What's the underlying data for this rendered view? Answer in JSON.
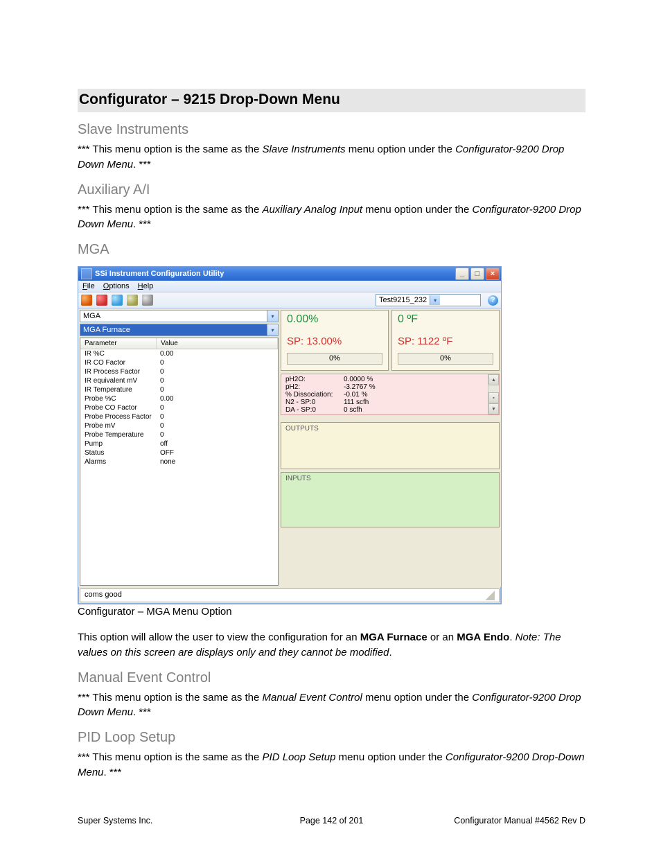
{
  "doc": {
    "h1": "Configurator – 9215 Drop-Down Menu",
    "sec1": {
      "title": "Slave Instruments",
      "p_a": "*** This menu option is the same as the ",
      "p_em": "Slave Instruments",
      "p_b": " menu option under the ",
      "p_em2": "Configurator-9200 Drop Down Menu",
      "p_c": ". ***"
    },
    "sec2": {
      "title": "Auxiliary A/I",
      "p_a": "*** This menu option is the same as the ",
      "p_em": "Auxiliary Analog Input",
      "p_b": " menu option under the ",
      "p_em2": "Configurator-9200 Drop Down Menu",
      "p_c": ". ***"
    },
    "sec3": {
      "title": "MGA"
    },
    "caption": "Configurator – MGA Menu Option",
    "para": {
      "a": "This option will allow the user to view the configuration for an ",
      "b1": "MGA Furnace",
      "mid": " or an ",
      "b2": "MGA Endo",
      "c": ".  ",
      "note": "Note: The values on this screen are displays only and they cannot be modified",
      "d": "."
    },
    "sec4": {
      "title": "Manual Event Control",
      "p_a": "*** This menu option is the same as the ",
      "p_em": "Manual Event Control",
      "p_b": " menu option under the ",
      "p_em2": "Configurator-9200 Drop Down Menu",
      "p_c": ". ***"
    },
    "sec5": {
      "title": "PID Loop Setup",
      "p_a": "*** This menu option is the same as the ",
      "p_em": "PID Loop Setup",
      "p_b": " menu option under the ",
      "p_em2": "Configurator-9200 Drop-Down Menu",
      "p_c": ". ***"
    }
  },
  "footer": {
    "left": "Super Systems Inc.",
    "mid": "Page 142 of 201",
    "right": "Configurator Manual #4562 Rev D"
  },
  "win": {
    "title": "SSi Instrument Configuration Utility",
    "menu": {
      "file": "File",
      "options": "Options",
      "help": "Help"
    },
    "device": "Test9215_232",
    "dd1": "MGA",
    "dd2": "MGA Furnace",
    "grid": {
      "h_param": "Parameter",
      "h_value": "Value",
      "rows": [
        {
          "p": "IR %C",
          "v": "0.00"
        },
        {
          "p": "IR CO Factor",
          "v": "0"
        },
        {
          "p": "IR Process Factor",
          "v": "0"
        },
        {
          "p": "IR equivalent mV",
          "v": "0"
        },
        {
          "p": "IR Temperature",
          "v": "0"
        },
        {
          "p": "Probe %C",
          "v": "0.00"
        },
        {
          "p": "Probe CO Factor",
          "v": "0"
        },
        {
          "p": "Probe Process Factor",
          "v": "0"
        },
        {
          "p": "Probe mV",
          "v": "0"
        },
        {
          "p": "Probe Temperature",
          "v": "0"
        },
        {
          "p": "Pump",
          "v": "off"
        },
        {
          "p": "Status",
          "v": "OFF"
        },
        {
          "p": "Alarms",
          "v": "none"
        }
      ]
    },
    "big1": {
      "val": "0.00%",
      "sp": "SP: 13.00%",
      "pct": "0%"
    },
    "big2": {
      "val": "0 ºF",
      "sp": "SP: 1122 ºF",
      "pct": "0%"
    },
    "kv": [
      {
        "k": "pH2O:",
        "v": "0.0000 %"
      },
      {
        "k": "pH2:",
        "v": "-3.2767 %"
      },
      {
        "k": "% Dissociation:",
        "v": "-0.01 %"
      },
      {
        "k": "N2 - SP:0",
        "v": "111 scfh"
      },
      {
        "k": "DA - SP:0",
        "v": "0 scfh"
      }
    ],
    "outputs": "OUTPUTS",
    "inputs": "INPUTS",
    "status": "coms good"
  }
}
